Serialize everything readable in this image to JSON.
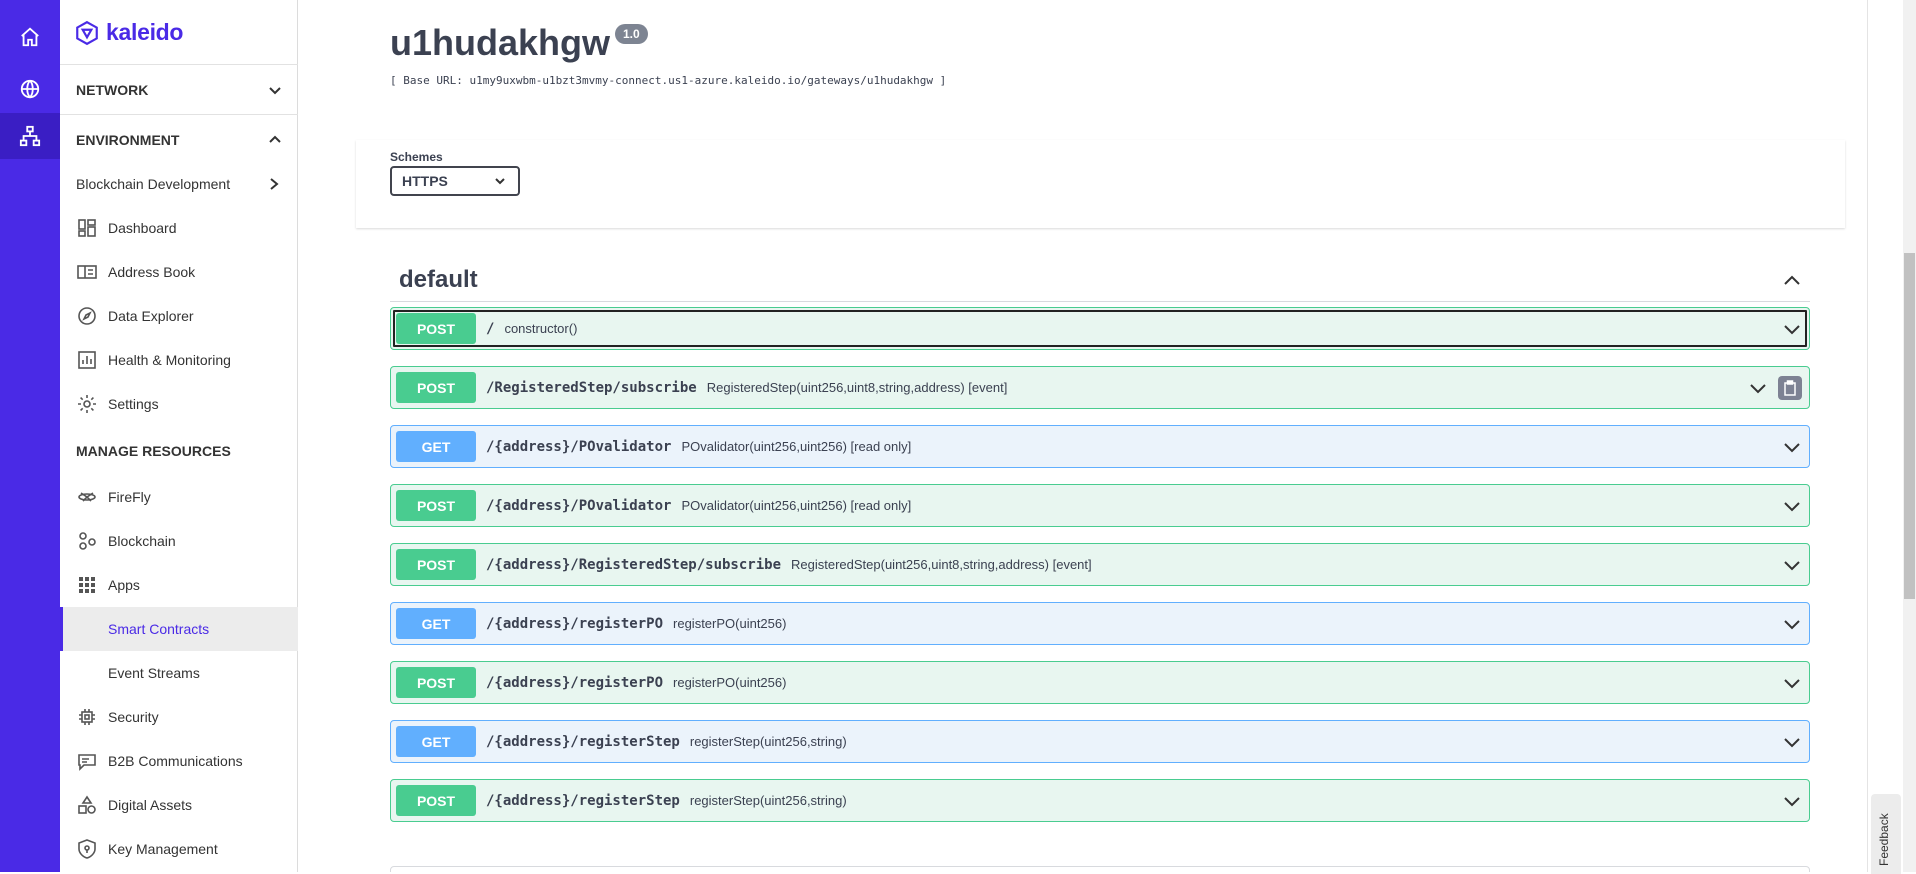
{
  "colors": {
    "rail": "#4a2ae6",
    "post": "#49cc90",
    "get": "#61affe",
    "accent": "#4a2ae6"
  },
  "rail": {
    "icons": [
      "home-icon",
      "globe-icon",
      "network-icon"
    ]
  },
  "sidebar": {
    "logo_text": "kaleido",
    "network_label": "NETWORK",
    "environment_label": "ENVIRONMENT",
    "items": [
      {
        "label": "Blockchain Development"
      },
      {
        "label": "Dashboard"
      },
      {
        "label": "Address Book"
      },
      {
        "label": "Data Explorer"
      },
      {
        "label": "Health & Monitoring"
      },
      {
        "label": "Settings"
      }
    ],
    "manage_heading": "MANAGE RESOURCES",
    "resources": [
      {
        "label": "FireFly"
      },
      {
        "label": "Blockchain"
      },
      {
        "label": "Apps"
      },
      {
        "label": "Smart Contracts"
      },
      {
        "label": "Event Streams"
      },
      {
        "label": "Security"
      },
      {
        "label": "B2B Communications"
      },
      {
        "label": "Digital Assets"
      },
      {
        "label": "Key Management"
      }
    ]
  },
  "api": {
    "title": "u1hudakhgw",
    "version": "1.0",
    "base_url": "[ Base URL: u1my9uxwbm-u1bzt3mvmy-connect.us1-azure.kaleido.io/gateways/u1hudakhgw ]",
    "schemes_label": "Schemes",
    "scheme_value": "HTTPS",
    "section_title": "default"
  },
  "operations": [
    {
      "method": "POST",
      "path": "/",
      "summary": "constructor()"
    },
    {
      "method": "POST",
      "path": "/RegisteredStep/subscribe",
      "summary": "RegisteredStep(uint256,uint8,string,address) [event]"
    },
    {
      "method": "GET",
      "path": "/{address}/POvalidator",
      "summary": "POvalidator(uint256,uint256) [read only]"
    },
    {
      "method": "POST",
      "path": "/{address}/POvalidator",
      "summary": "POvalidator(uint256,uint256) [read only]"
    },
    {
      "method": "POST",
      "path": "/{address}/RegisteredStep/subscribe",
      "summary": "RegisteredStep(uint256,uint8,string,address) [event]"
    },
    {
      "method": "GET",
      "path": "/{address}/registerPO",
      "summary": "registerPO(uint256)"
    },
    {
      "method": "POST",
      "path": "/{address}/registerPO",
      "summary": "registerPO(uint256)"
    },
    {
      "method": "GET",
      "path": "/{address}/registerStep",
      "summary": "registerStep(uint256,string)"
    },
    {
      "method": "POST",
      "path": "/{address}/registerStep",
      "summary": "registerStep(uint256,string)"
    }
  ],
  "feedback_label": "Feedback"
}
